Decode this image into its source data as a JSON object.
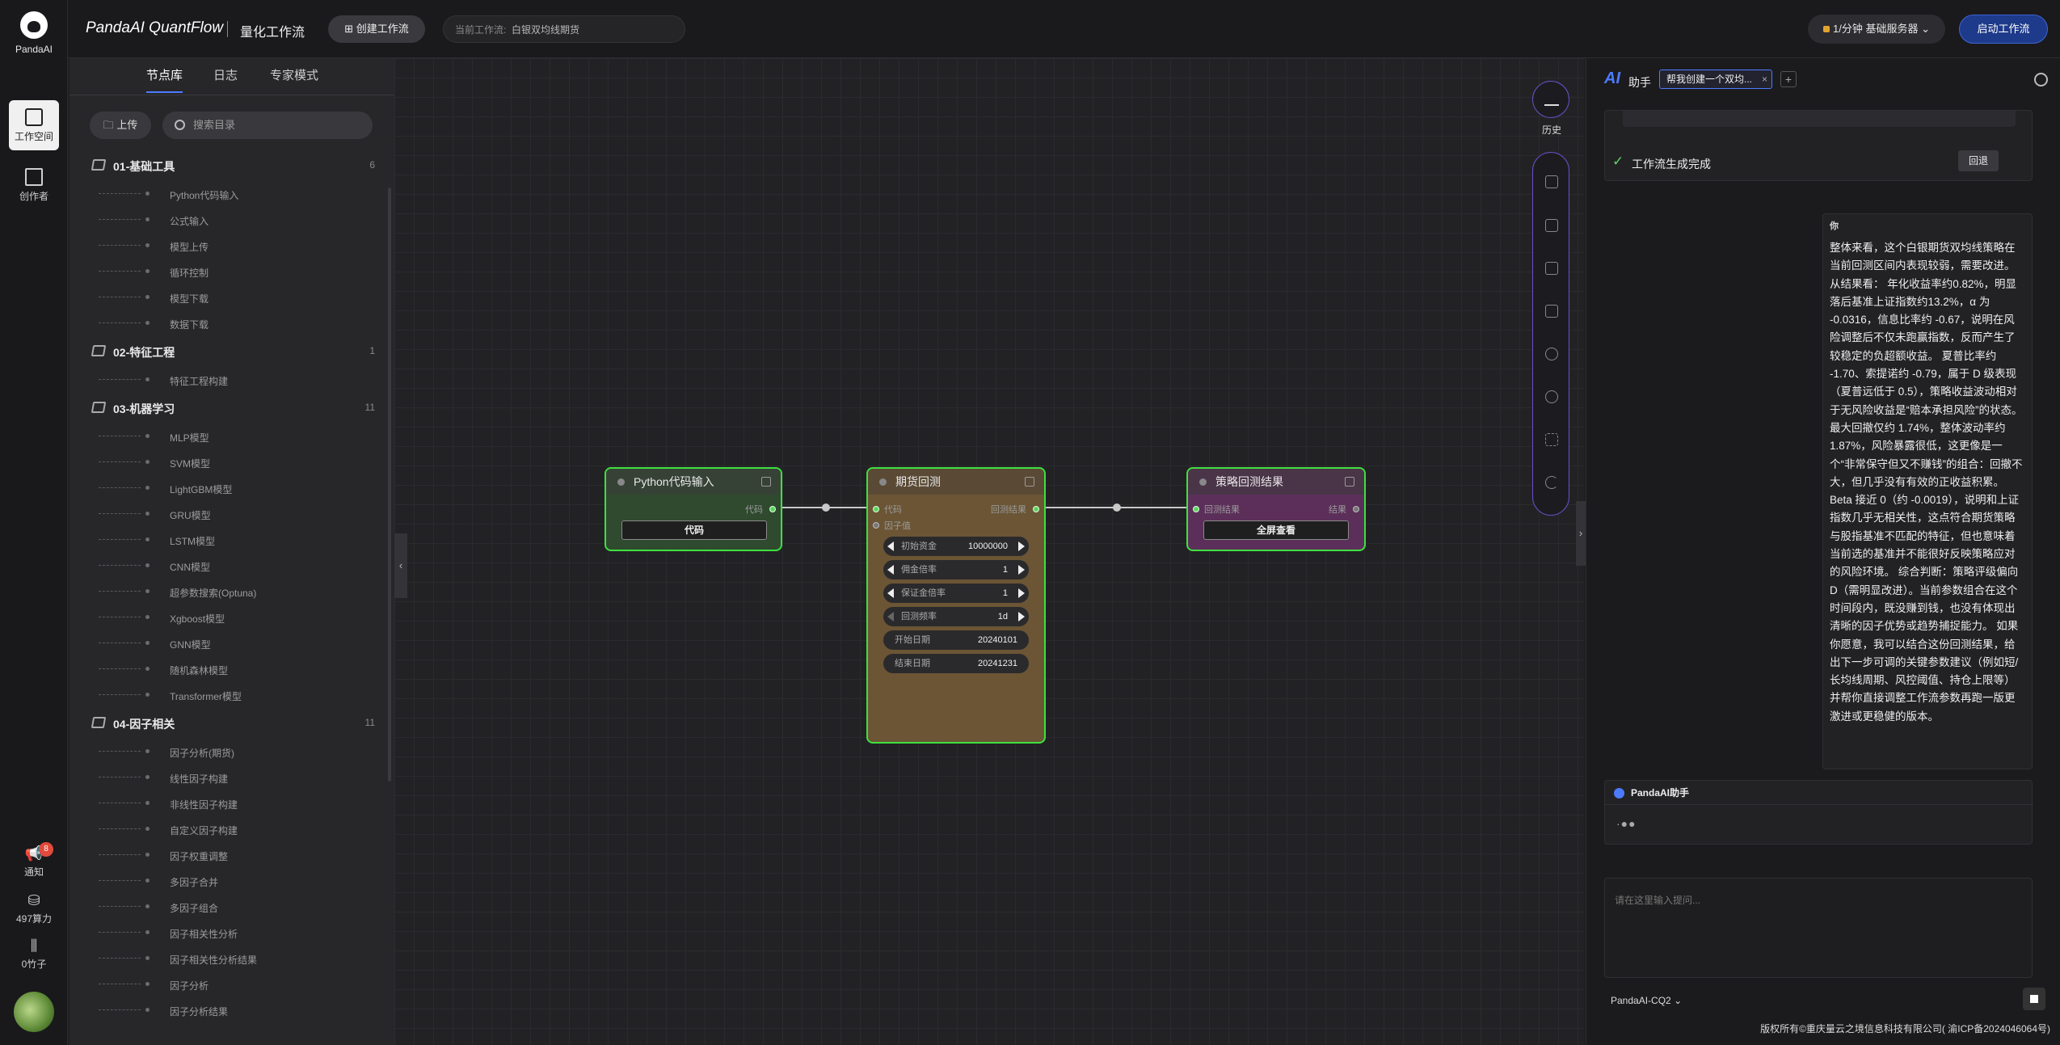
{
  "app": {
    "logo_text": "PandaAI",
    "brand": "PandaAI QuantFlow",
    "subtitle": "量化工作流"
  },
  "toolbar": {
    "create_label": "创建工作流",
    "current_label": "当前工作流:",
    "current_value": "白银双均线期货",
    "server_label": "1/分钟 基础服务器",
    "start_label": "启动工作流"
  },
  "rail": {
    "items": [
      {
        "label": "工作空间"
      },
      {
        "label": "创作者"
      }
    ],
    "bottom": {
      "notify": "通知",
      "notify_badge": "8",
      "compute": "497算力",
      "bamboo": "0竹子"
    }
  },
  "library": {
    "tabs": [
      "节点库",
      "日志",
      "专家模式"
    ],
    "upload_label": "上传",
    "search_placeholder": "搜索目录",
    "categories": [
      {
        "name": "01-基础工具",
        "count": "6",
        "items": [
          "Python代码输入",
          "公式输入",
          "模型上传",
          "循环控制",
          "模型下载",
          "数据下载"
        ]
      },
      {
        "name": "02-特征工程",
        "count": "1",
        "items": [
          "特征工程构建"
        ]
      },
      {
        "name": "03-机器学习",
        "count": "11",
        "items": [
          "MLP模型",
          "SVM模型",
          "LightGBM模型",
          "GRU模型",
          "LSTM模型",
          "CNN模型",
          "超参数搜索(Optuna)",
          "Xgboost模型",
          "GNN模型",
          "随机森林模型",
          "Transformer模型"
        ]
      },
      {
        "name": "04-因子相关",
        "count": "11",
        "items": [
          "因子分析(期货)",
          "线性因子构建",
          "非线性因子构建",
          "自定义因子构建",
          "因子权重调整",
          "多因子合并",
          "多因子组合",
          "因子相关性分析",
          "因子相关性分析结果",
          "因子分析",
          "因子分析结果"
        ]
      }
    ]
  },
  "canvas": {
    "nodes": {
      "python": {
        "title": "Python代码输入",
        "out_port": "代码",
        "button": "代码"
      },
      "backtest": {
        "title": "期货回测",
        "in_ports": [
          "代码",
          "因子值"
        ],
        "out_port": "回测结果",
        "params": [
          {
            "name": "初始资金",
            "value": "10000000"
          },
          {
            "name": "佣金倍率",
            "value": "1"
          },
          {
            "name": "保证金倍率",
            "value": "1"
          },
          {
            "name": "回测频率",
            "value": "1d"
          },
          {
            "name": "开始日期",
            "value": "20240101"
          },
          {
            "name": "结束日期",
            "value": "20241231"
          }
        ]
      },
      "result": {
        "title": "策略回测结果",
        "in_port": "回测结果",
        "out_port": "结果",
        "button": "全屏查看"
      }
    },
    "history_label": "历史"
  },
  "assistant": {
    "logo": "AI",
    "title": "助手",
    "tab_label": "帮我创建一个双均...",
    "done_label": "工作流生成完成",
    "rollback_label": "回退",
    "you_label": "你",
    "message": "整体来看，这个白银期货双均线策略在当前回测区间内表现较弱，需要改进。 从结果看： 年化收益率约0.82%，明显落后基准上证指数约13.2%，α 为 -0.0316，信息比率约 -0.67，说明在风险调整后不仅未跑赢指数，反而产生了较稳定的负超额收益。 夏普比率约 -1.70、索提诺约 -0.79，属于 D 级表现（夏普远低于 0.5），策略收益波动相对于无风险收益是“赔本承担风险”的状态。 最大回撤仅约 1.74%，整体波动率约 1.87%，风险暴露很低，这更像是一个“非常保守但又不赚钱”的组合：回撤不大，但几乎没有有效的正收益积累。 Beta 接近 0（约 -0.0019），说明和上证指数几乎无相关性，这点符合期货策略与股指基准不匹配的特征，但也意味着当前选的基准并不能很好反映策略应对的风险环境。 综合判断：策略评级偏向 D（需明显改进）。当前参数组合在这个时间段内，既没赚到钱，也没有体现出清晰的因子优势或趋势捕捉能力。 如果你愿意，我可以结合这份回测结果，给出下一步可调的关键参数建议（例如短/长均线周期、风控阈值、持仓上限等）并帮你直接调整工作流参数再跑一版更激进或更稳健的版本。",
    "bot_name": "PandaAI助手",
    "input_placeholder": "请在这里输入提问...",
    "model": "PandaAI-CQ2"
  },
  "footer": {
    "copyright": "版权所有©重庆量云之境信息科技有限公司( 渝ICP备2024046064号)"
  }
}
